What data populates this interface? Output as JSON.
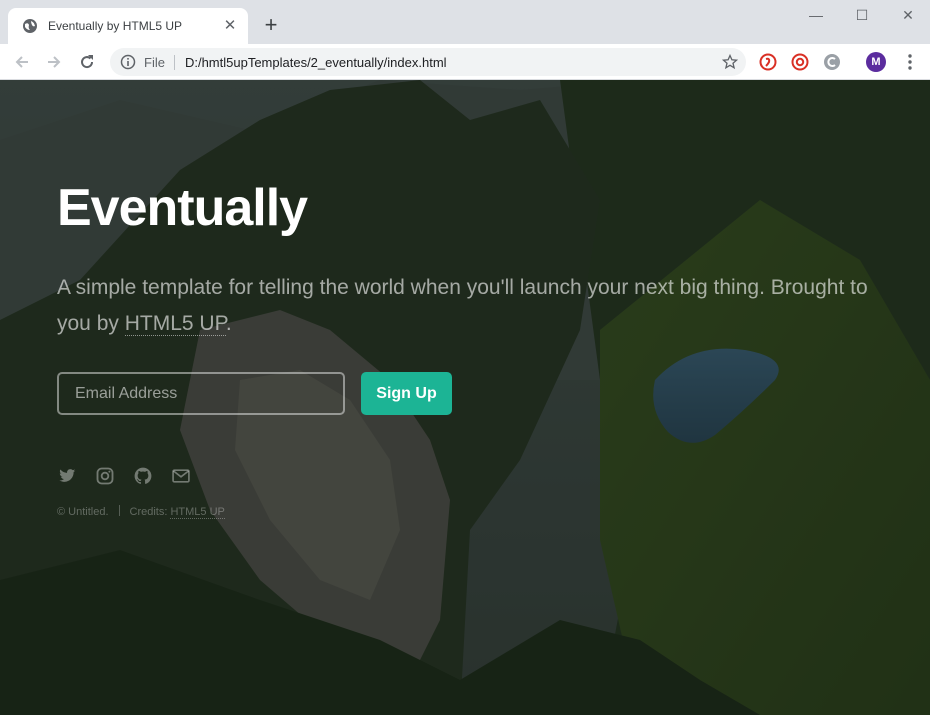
{
  "browser": {
    "tab_title": "Eventually by HTML5 UP",
    "tab_close": "✕",
    "new_tab": "+",
    "scheme_label": "File",
    "url": "D:/hmtl5upTemplates/2_eventually/index.html",
    "profile_initial": "M",
    "window_controls": {
      "minimize": "—",
      "maximize": "☐",
      "close": "✕"
    }
  },
  "page": {
    "heading": "Eventually",
    "tagline_text": "A simple template for telling the world when you'll launch your next big thing. Brought to you by ",
    "tagline_link": "HTML5 UP",
    "tagline_end": ".",
    "email_placeholder": "Email Address",
    "signup_label": "Sign Up",
    "social_icons": [
      "twitter-icon",
      "instagram-icon",
      "github-icon",
      "envelope-icon"
    ],
    "footer_copyright": "© Untitled.",
    "footer_credits_label": "Credits: ",
    "footer_credits_link": "HTML5 UP"
  },
  "colors": {
    "accent": "#1cb495",
    "profile": "#5b2c9e",
    "ext_red": "#d93025",
    "ext_grey": "#9aa0a6"
  }
}
